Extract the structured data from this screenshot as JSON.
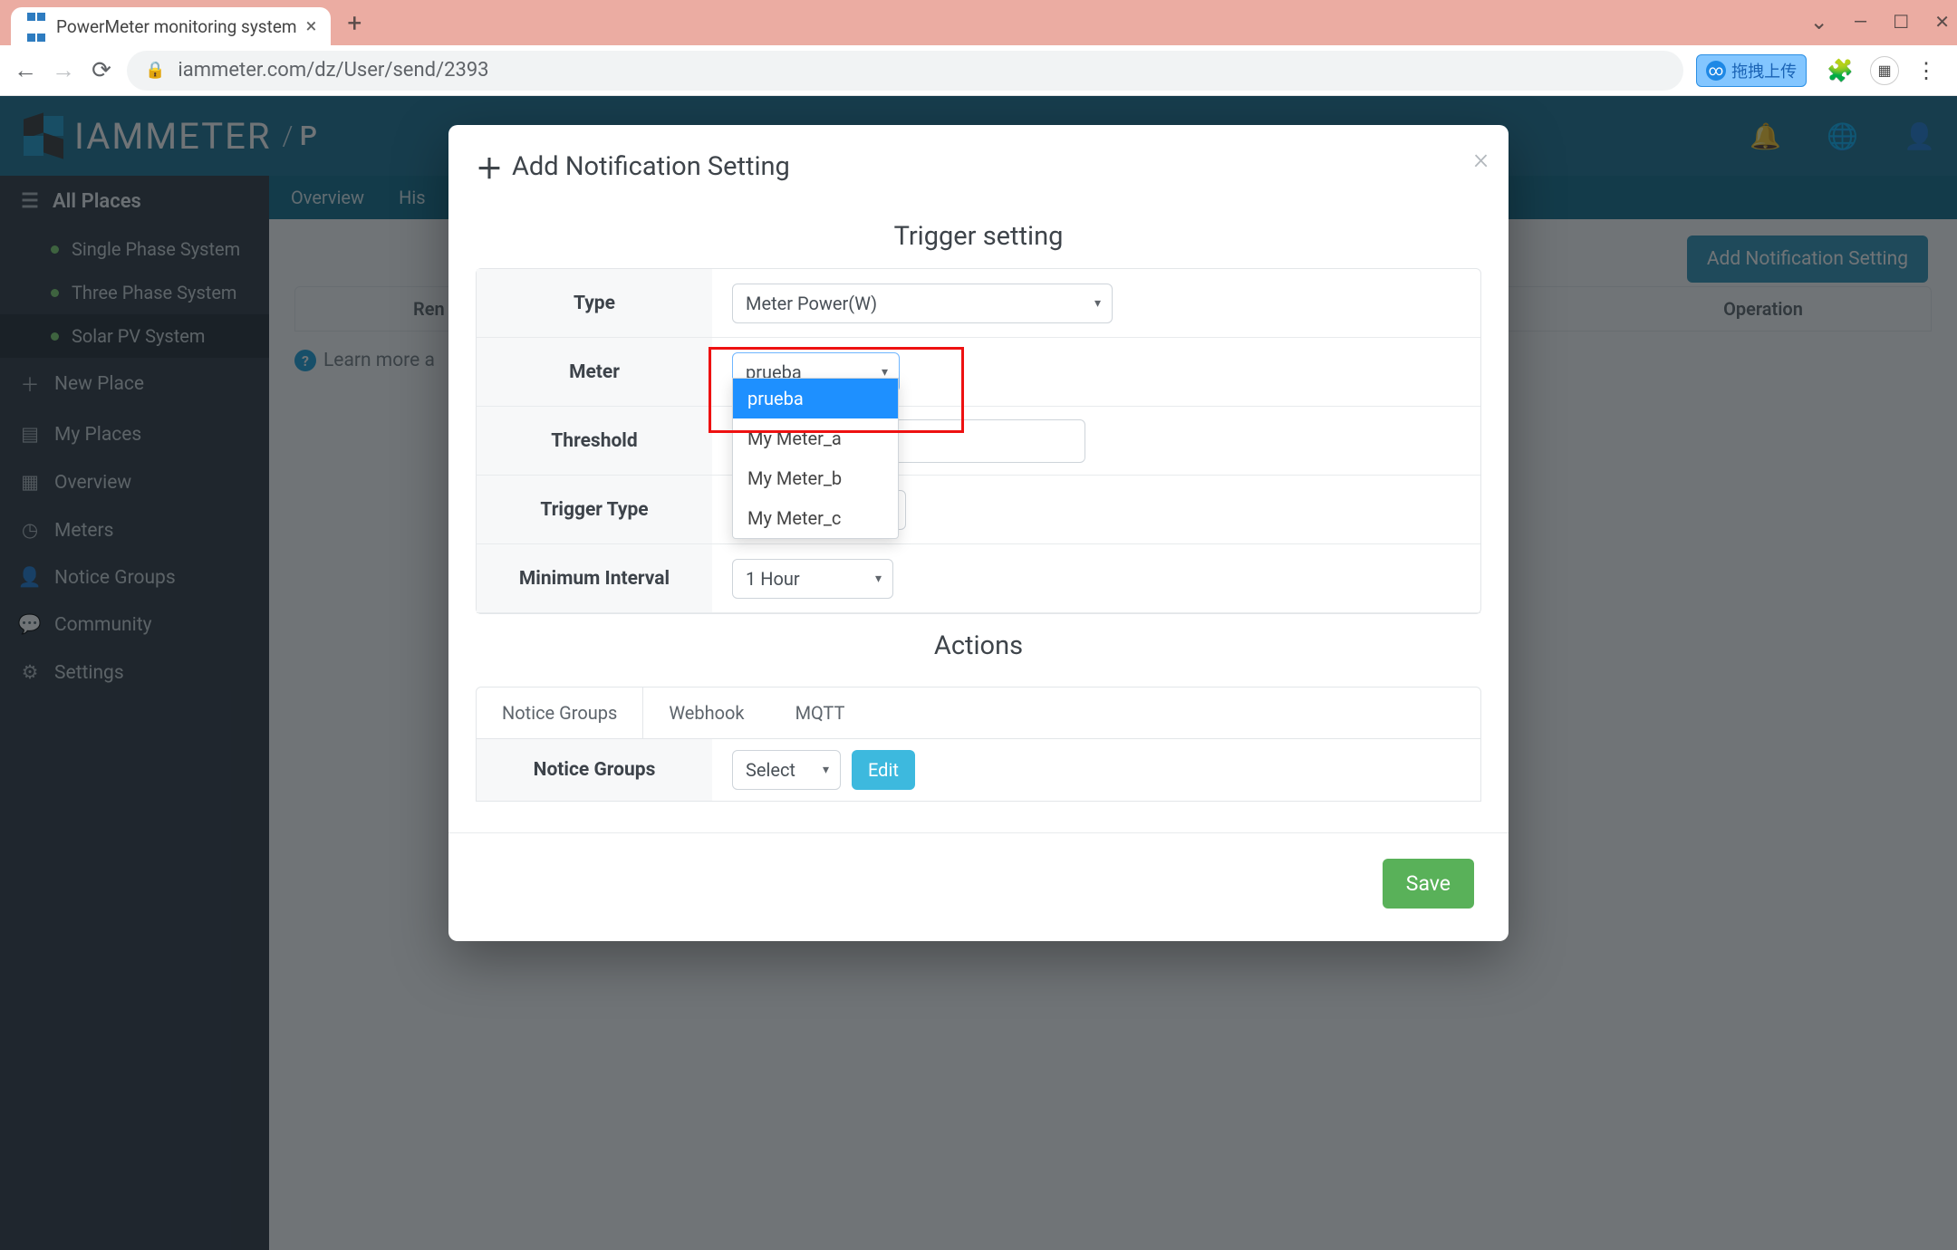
{
  "browser": {
    "tab_title": "PowerMeter monitoring system",
    "url": "iammeter.com/dz/User/send/2393",
    "ext_badge_text": "拖拽上传"
  },
  "header": {
    "brand": "IAMMETER",
    "crumb_prefix": "/",
    "crumb": "P"
  },
  "sidebar": {
    "all_places": "All Places",
    "subs": [
      {
        "label": "Single Phase System"
      },
      {
        "label": "Three Phase System"
      },
      {
        "label": "Solar PV System"
      }
    ],
    "items": [
      {
        "label": "New Place",
        "icon": "＋"
      },
      {
        "label": "My Places",
        "icon": "▤"
      },
      {
        "label": "Overview",
        "icon": "▦"
      },
      {
        "label": "Meters",
        "icon": "◷"
      },
      {
        "label": "Notice Groups",
        "icon": "👤"
      },
      {
        "label": "Community",
        "icon": "💬"
      },
      {
        "label": "Settings",
        "icon": "⚙"
      }
    ]
  },
  "content": {
    "tabs": [
      "Overview",
      "His"
    ],
    "add_button": "Add Notification Setting",
    "table_headers": {
      "remark": "Ren",
      "operation": "Operation"
    },
    "learn_more": "Learn more a"
  },
  "modal": {
    "title": "Add Notification Setting",
    "trigger_title": "Trigger setting",
    "actions_title": "Actions",
    "fields": {
      "type": {
        "label": "Type",
        "value": "Meter Power(W)"
      },
      "meter": {
        "label": "Meter",
        "value": "prueba"
      },
      "threshold": {
        "label": "Threshold"
      },
      "trigger_type": {
        "label": "Trigger Type"
      },
      "min_interval": {
        "label": "Minimum Interval",
        "value": "1 Hour"
      }
    },
    "meter_options": [
      "prueba",
      "My Meter_a",
      "My Meter_b",
      "My Meter_c"
    ],
    "action_tabs": [
      "Notice Groups",
      "Webhook",
      "MQTT"
    ],
    "notice_groups_label": "Notice Groups",
    "notice_groups_select": "Select",
    "edit": "Edit",
    "save": "Save"
  }
}
